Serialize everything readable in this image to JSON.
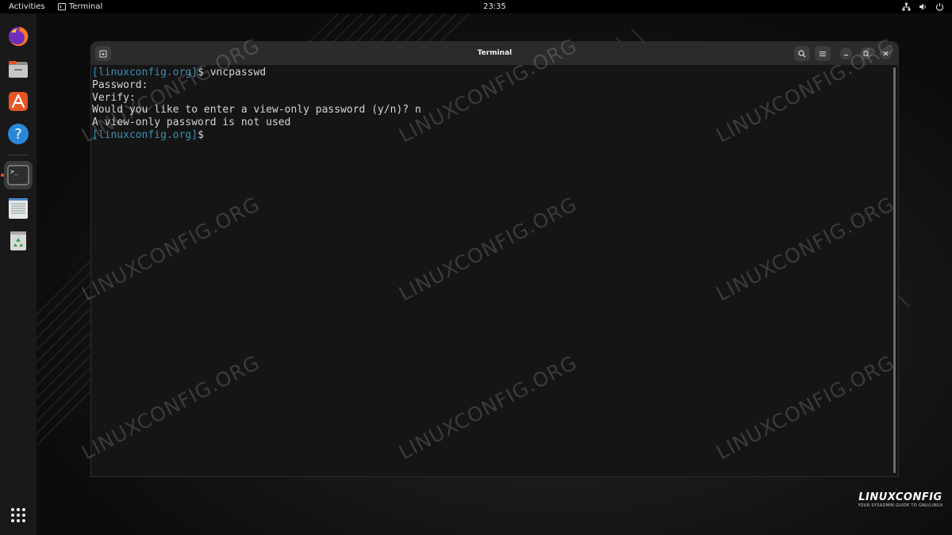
{
  "topbar": {
    "activities": "Activities",
    "app_name": "Terminal",
    "clock": "23:35"
  },
  "dock": {
    "items": [
      "firefox-icon",
      "files-icon",
      "software-icon",
      "help-icon",
      "terminal-icon",
      "text-editor-icon",
      "trash-icon"
    ],
    "app_grid": "app-grid-icon"
  },
  "terminal": {
    "title": "Terminal",
    "lines": [
      {
        "prompt": "[linuxconfig.org]",
        "text": "$ vncpasswd"
      },
      {
        "prompt": "",
        "text": "Password:"
      },
      {
        "prompt": "",
        "text": "Verify:"
      },
      {
        "prompt": "",
        "text": "Would you like to enter a view-only password (y/n)? n"
      },
      {
        "prompt": "",
        "text": "A view-only password is not used"
      },
      {
        "prompt": "[linuxconfig.org]",
        "text": "$ "
      }
    ]
  },
  "watermark": "LINUXCONFIG.ORG",
  "brand": {
    "logo": "LINUXCONFIG",
    "tagline": "YOUR SYSADMIN GUIDE TO GNU/LINUX"
  },
  "colors": {
    "prompt": "#3b8fb5",
    "ubuntu_orange": "#e95420"
  }
}
